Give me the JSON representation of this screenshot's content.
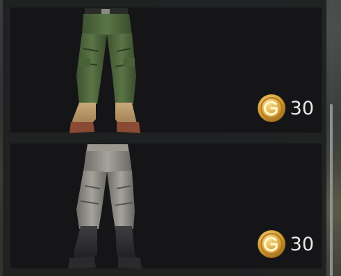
{
  "store": {
    "items": [
      {
        "icon": "green-cargo-pants-with-tan-boots",
        "price": "30",
        "currency_icon": "gold-g-coin-icon"
      },
      {
        "icon": "gray-pants-with-black-boots",
        "price": "30",
        "currency_icon": "gold-g-coin-icon"
      }
    ]
  },
  "colors": {
    "card_bg": "#151517",
    "coin_gold": "#d9a23a",
    "price_text": "#e9e9e9",
    "scroll_thumb": "#8e9194"
  }
}
